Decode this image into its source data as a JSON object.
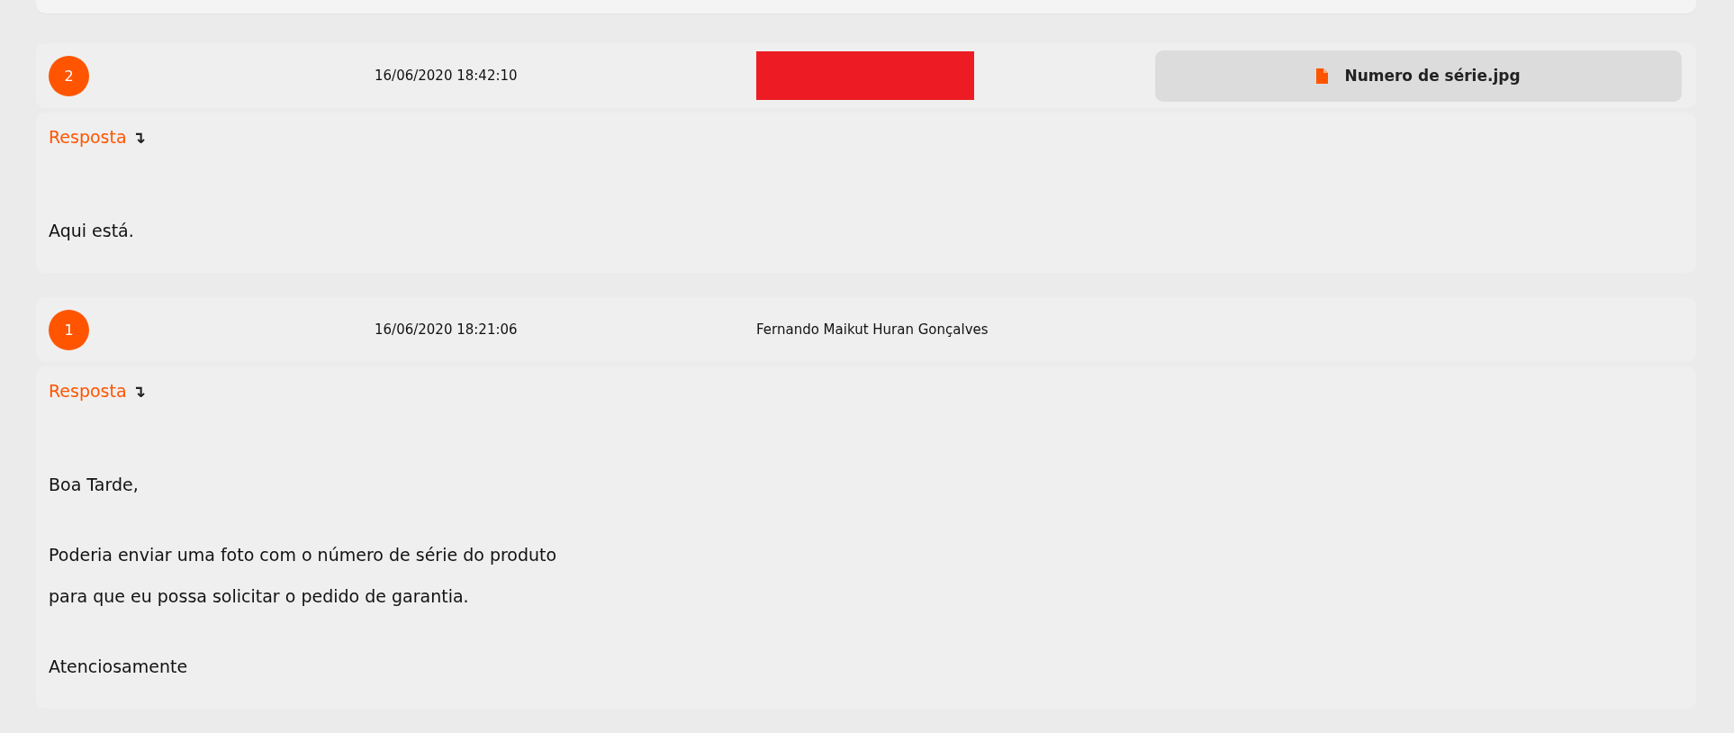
{
  "messages": [
    {
      "number": "2",
      "date": "16/06/2020 18:42:10",
      "redacted": true,
      "attachment": {
        "name": "Numero de série.jpg"
      },
      "reply_label": "Resposta",
      "reply_arrow": "↴",
      "paragraphs": [
        [
          "Aqui está."
        ]
      ]
    },
    {
      "number": "1",
      "date": "16/06/2020 18:21:06",
      "author": "Fernando Maikut Huran Gonçalves",
      "redacted": false,
      "reply_label": "Resposta",
      "reply_arrow": "↴",
      "paragraphs": [
        [
          "Boa Tarde,"
        ],
        [
          "Poderia enviar uma foto com o número de série do produto",
          "para que eu possa solicitar o pedido de garantia."
        ],
        [
          "Atenciosamente"
        ]
      ]
    }
  ]
}
